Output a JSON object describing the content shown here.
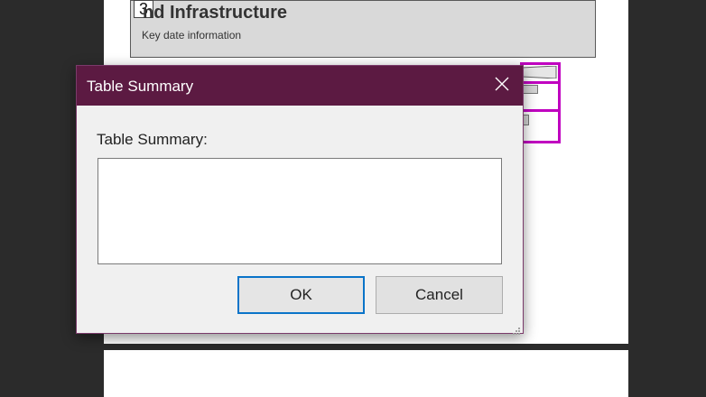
{
  "document": {
    "page_number": "3",
    "header_title": "nd Infrastructure",
    "header_subtitle": "Key date information"
  },
  "dialog": {
    "title": "Table Summary",
    "close_icon": "close-icon",
    "field_label": "Table Summary:",
    "summary_value": "",
    "ok_label": "OK",
    "cancel_label": "Cancel",
    "resize_icon": "resize-grip-icon"
  },
  "colors": {
    "titlebar": "#5c1a42",
    "selection": "#c000c0",
    "ok_focus": "#0a74c9"
  }
}
